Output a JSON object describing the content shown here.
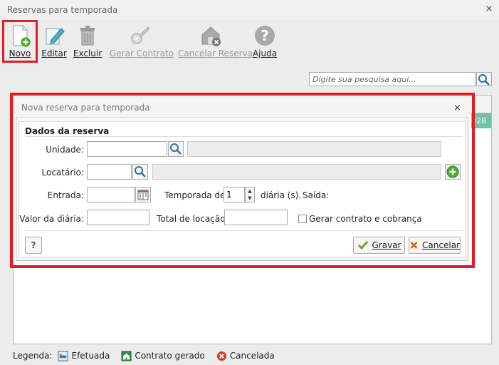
{
  "window": {
    "title": "Reservas para temporada",
    "close_glyph": "⨯"
  },
  "toolbar": {
    "items": [
      {
        "label": "Novo",
        "icon": "new-document-icon",
        "enabled": true
      },
      {
        "label": "Editar",
        "icon": "edit-icon",
        "enabled": true
      },
      {
        "label": "Excluir",
        "icon": "trash-icon",
        "enabled": true
      },
      {
        "label": "Gerar Contrato",
        "icon": "gear-contract-icon",
        "enabled": false
      },
      {
        "label": "Cancelar Reserva",
        "icon": "house-cancel-icon",
        "enabled": false
      },
      {
        "label": "Ajuda",
        "icon": "help-icon",
        "enabled": true
      }
    ]
  },
  "search": {
    "placeholder": "Digite sua pesquisa aqui..."
  },
  "grid": {
    "visible_cell": "028"
  },
  "legend": {
    "label": "Legenda:",
    "items": [
      {
        "label": "Efetuada",
        "icon": "bed-icon"
      },
      {
        "label": "Contrato gerado",
        "icon": "house-green-icon"
      },
      {
        "label": "Cancelada",
        "icon": "cancel-circle-icon"
      }
    ]
  },
  "dialog": {
    "title": "Nova reserva para temporada",
    "close_glyph": "⨯",
    "section_title": "Dados da reserva",
    "fields": {
      "unidade_label": "Unidade:",
      "locatario_label": "Locatário:",
      "entrada_label": "Entrada:",
      "temporada_label": "Temporada de:",
      "temporada_value": "1",
      "diarias_suffix": "diária (s).",
      "saida_label": "Saída:",
      "valor_diaria_label": "Valor da diária:",
      "total_locacao_label": "Total de locação:",
      "gerar_contrato_label": "Gerar contrato e cobrança"
    },
    "help_glyph": "?",
    "buttons": {
      "save_label": "Gravar",
      "cancel_label": "Cancelar"
    }
  },
  "colors": {
    "highlight": "#e11c24",
    "accent_green": "#6cc3a7",
    "add_green": "#4caf30"
  }
}
